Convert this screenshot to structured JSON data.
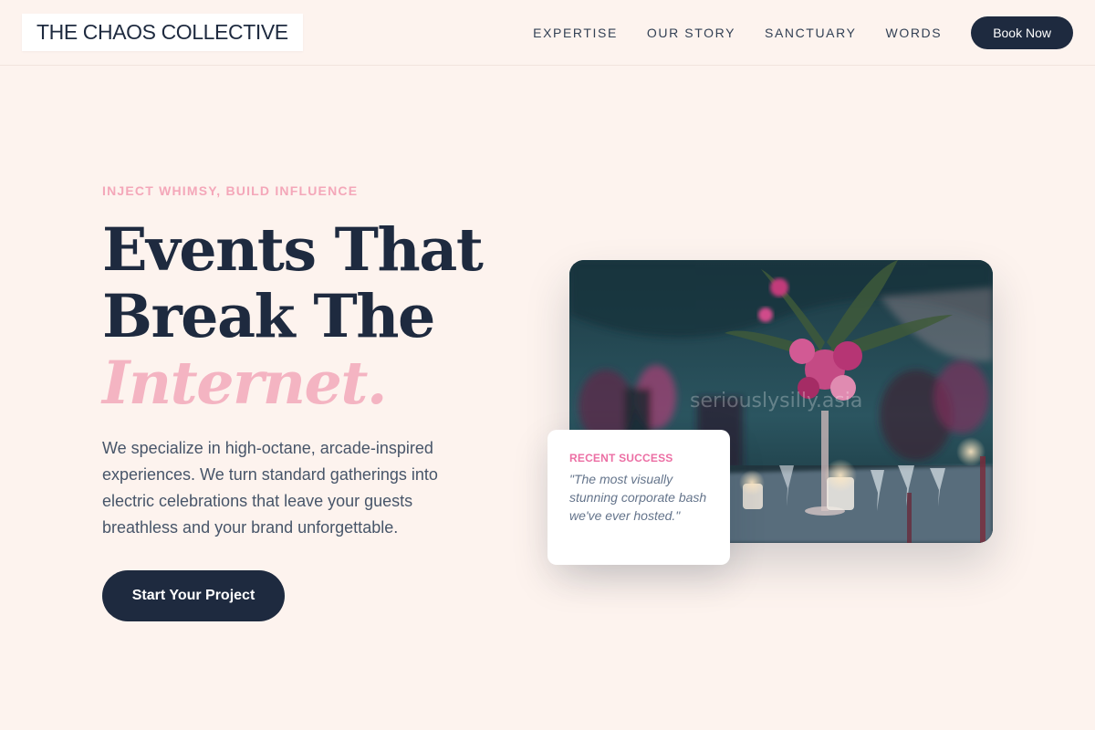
{
  "header": {
    "logo": "THE CHAOS COLLECTIVE",
    "nav": [
      {
        "label": "EXPERTISE"
      },
      {
        "label": "OUR STORY"
      },
      {
        "label": "SANCTUARY"
      },
      {
        "label": "WORDS"
      }
    ],
    "book_label": "Book Now"
  },
  "hero": {
    "eyebrow": "INJECT WHIMSY, BUILD INFLUENCE",
    "headline_line1": "Events That",
    "headline_line2": "Break The",
    "headline_accent": "Internet.",
    "lede": "We specialize in high-octane, arcade-inspired experiences. We turn standard gatherings into electric celebrations that leave your guests breathless and your brand unforgettable.",
    "cta_label": "Start Your Project",
    "image_watermark": "seriouslysilly.asia"
  },
  "testimonial": {
    "label": "RECENT SUCCESS",
    "quote": "\"The most visually stunning corporate bash we've ever hosted.\""
  },
  "colors": {
    "background": "#fdf3ee",
    "navy": "#1e2a3f",
    "pink_accent": "#f4b4c2",
    "pink_label": "#ec6fa4"
  }
}
